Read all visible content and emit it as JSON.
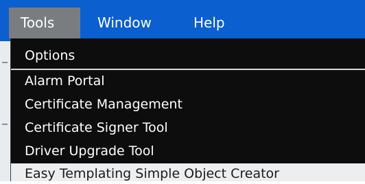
{
  "menubar": {
    "menus": [
      {
        "label": "Tools",
        "active": true
      },
      {
        "label": "Window",
        "active": false
      },
      {
        "label": "Help",
        "active": false
      }
    ]
  },
  "tools_menu": {
    "items": [
      {
        "label": "Options"
      },
      {
        "label": "Alarm Portal"
      },
      {
        "label": "Certificate Management"
      },
      {
        "label": "Certificate Signer Tool"
      },
      {
        "label": "Driver Upgrade Tool"
      },
      {
        "label": "Easy Templating Simple Object Creator",
        "highlighted": true
      }
    ]
  },
  "colors": {
    "menubar_background": "#0b5fcf",
    "active_menu_background": "#7a7d80",
    "dropdown_background": "#0d0d0d",
    "highlight_background": "#eceef0"
  }
}
